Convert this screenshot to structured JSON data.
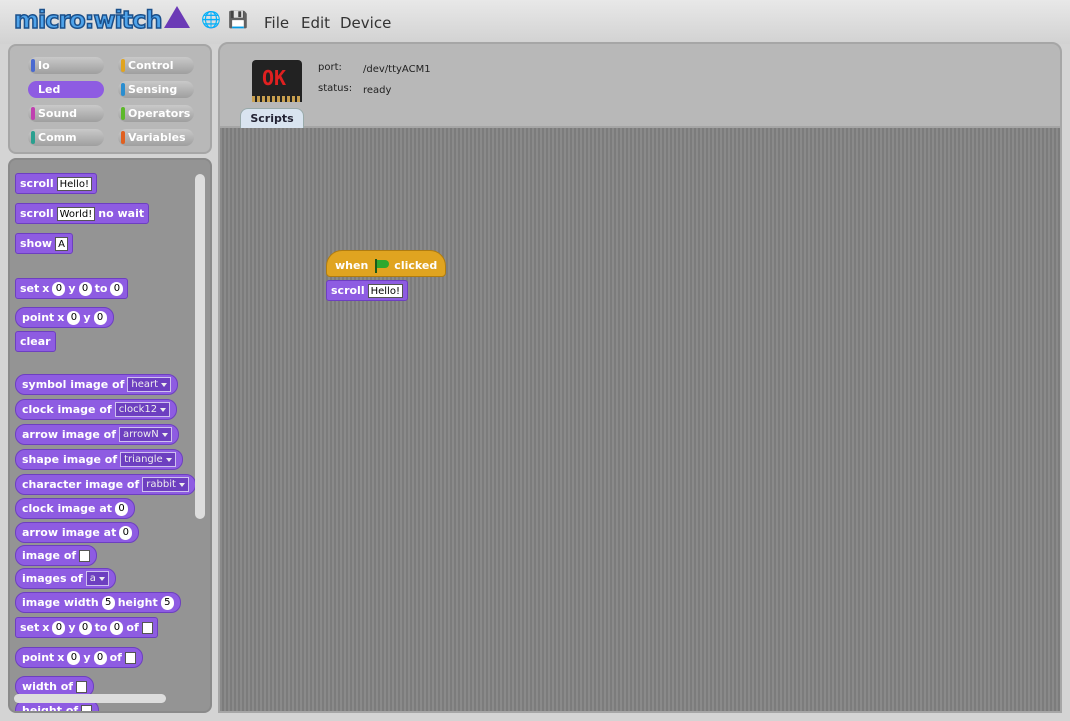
{
  "app": {
    "logo": "micro:witch"
  },
  "menu": {
    "file": "File",
    "edit": "Edit",
    "device": "Device"
  },
  "categories": [
    {
      "label": "Io",
      "color": "#4a6ad0",
      "selected": false
    },
    {
      "label": "Control",
      "color": "#e0a420",
      "selected": false
    },
    {
      "label": "Led",
      "color": "#8e5ce2",
      "selected": true
    },
    {
      "label": "Sensing",
      "color": "#2a8ed0",
      "selected": false
    },
    {
      "label": "Sound",
      "color": "#c040b0",
      "selected": false
    },
    {
      "label": "Operators",
      "color": "#5cb82a",
      "selected": false
    },
    {
      "label": "Comm",
      "color": "#2aa090",
      "selected": false
    },
    {
      "label": "Variables",
      "color": "#e06020",
      "selected": false
    }
  ],
  "palette": {
    "scroll": "scroll",
    "hello": "Hello!",
    "world": "World!",
    "no_wait": "no wait",
    "show": "show",
    "a": "A",
    "set": "set",
    "x": "x",
    "y": "y",
    "to": "to",
    "zero": "0",
    "point": "point",
    "clear": "clear",
    "symbol_image_of": "symbol image of",
    "heart": "heart",
    "clock_image_of": "clock image of",
    "clock12": "clock12",
    "arrow_image_of": "arrow image of",
    "arrowN": "arrowN",
    "shape_image_of": "shape image of",
    "triangle": "triangle",
    "character_image_of": "character image of",
    "rabbit": "rabbit",
    "clock_image_at": "clock image at",
    "arrow_image_at": "arrow image at",
    "image_of": "image of",
    "images_of": "images of",
    "a_lower": "a",
    "image_width": "image width",
    "height": "height",
    "five": "5",
    "of": "of",
    "width_of": "width of",
    "height_of": "height of"
  },
  "header": {
    "port_label": "port:",
    "port_value": "/dev/ttyACM1",
    "status_label": "status:",
    "status_value": "ready",
    "board_text": "OK",
    "tab": "Scripts"
  },
  "script": {
    "when": "when",
    "clicked": "clicked",
    "scroll": "scroll",
    "hello": "Hello!"
  }
}
